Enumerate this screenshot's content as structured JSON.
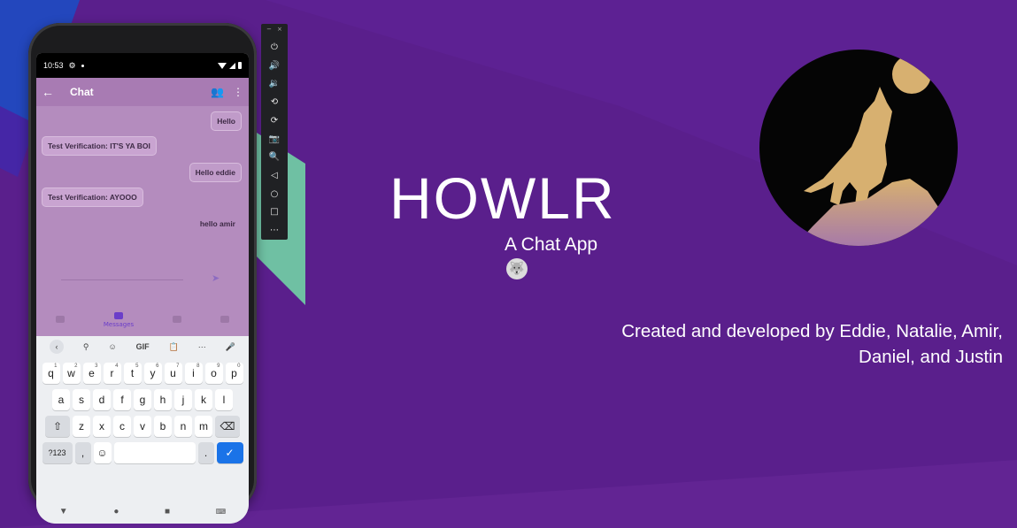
{
  "colors": {
    "background": "#5a1f8c",
    "accent_stripe_blue": "#1a4fc6",
    "accent_stripe_green": "#6fc0a3",
    "app_bar": "#a87bb3",
    "logo_bg": "#050505",
    "logo_gold": "#d7b070"
  },
  "phone": {
    "status_time": "10:53",
    "appbar": {
      "title": "Chat",
      "back_icon": "arrow-left-icon",
      "add_icon": "add-people-icon",
      "menu_icon": "more-vert-icon"
    },
    "messages": [
      {
        "text": "Hello",
        "side": "right"
      },
      {
        "text": "Test Verification: IT'S YA BOI",
        "side": "left"
      },
      {
        "text": "Hello eddie",
        "side": "right"
      },
      {
        "text": "Test Verification: AYOOO",
        "side": "left"
      },
      {
        "text": "hello amir",
        "side": "right"
      }
    ],
    "bottom_nav": {
      "active_label": "Messages"
    },
    "keyboard": {
      "tools": {
        "gif": "GIF"
      },
      "row1": [
        "q",
        "w",
        "e",
        "r",
        "t",
        "y",
        "u",
        "i",
        "o",
        "p"
      ],
      "row1_sup": [
        "1",
        "2",
        "3",
        "4",
        "5",
        "6",
        "7",
        "8",
        "9",
        "0"
      ],
      "row2": [
        "a",
        "s",
        "d",
        "f",
        "g",
        "h",
        "j",
        "k",
        "l"
      ],
      "row3": [
        "z",
        "x",
        "c",
        "v",
        "b",
        "n",
        "m"
      ],
      "symbols_key": "?123",
      "comma": ",",
      "period": "."
    }
  },
  "hero": {
    "title": "HOWLR",
    "subtitle": "A Chat App",
    "emoji": "🐺",
    "credits_line1": "Created and developed by Eddie, Natalie, Amir,",
    "credits_line2": "Daniel, and Justin"
  }
}
